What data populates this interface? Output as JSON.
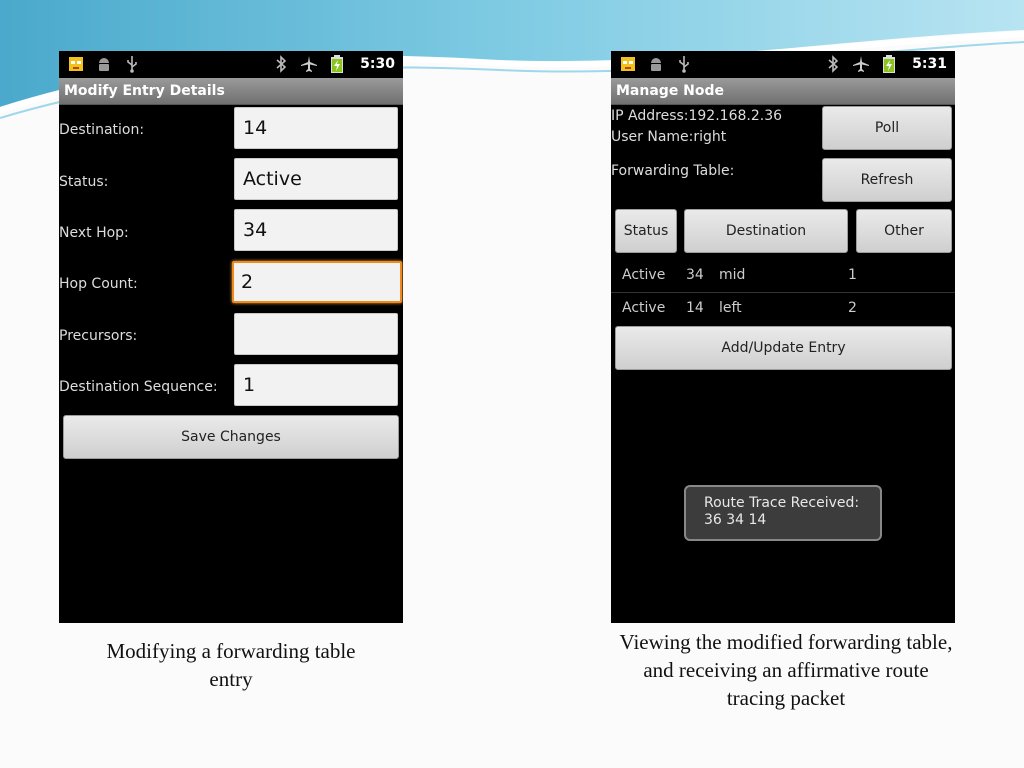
{
  "left_phone": {
    "status": {
      "time": "5:30"
    },
    "title": "Modify Entry Details",
    "fields": [
      {
        "label": "Destination:",
        "value": "14"
      },
      {
        "label": "Status:",
        "value": "Active"
      },
      {
        "label": "Next Hop:",
        "value": "34"
      },
      {
        "label": "Hop Count:",
        "value": "2"
      },
      {
        "label": "Precursors:",
        "value": ""
      },
      {
        "label": "Destination Sequence:",
        "value": "1"
      }
    ],
    "save_button": "Save Changes"
  },
  "right_phone": {
    "status": {
      "time": "5:31"
    },
    "title": "Manage Node",
    "ip_address": "IP Address:192.168.2.36",
    "user_name": "User Name:right",
    "forwarding_table_label": "Forwarding Table:",
    "poll_button": "Poll",
    "refresh_button": "Refresh",
    "columns": [
      "Status",
      "Destination",
      "Other"
    ],
    "rows": [
      {
        "status": "Active",
        "destination": "34",
        "next": "mid",
        "hops": "1"
      },
      {
        "status": "Active",
        "destination": "14",
        "next": "left",
        "hops": "2"
      }
    ],
    "add_update_button": "Add/Update Entry",
    "toast": {
      "line1": "Route Trace Received:",
      "line2": "36 34 14"
    }
  },
  "captions": {
    "left": "Modifying a forwarding table entry",
    "right": "Viewing the modified forwarding table, and receiving an affirmative route tracing packet"
  },
  "colors": {
    "focus_accent": "#f08a1c",
    "slide_background": "#fbfbfb",
    "swoosh_blue": "#5bb8d8"
  },
  "icons": [
    "app-icon",
    "android-icon",
    "usb-icon",
    "bluetooth-icon",
    "airplane-mode-icon",
    "battery-charging-icon"
  ]
}
